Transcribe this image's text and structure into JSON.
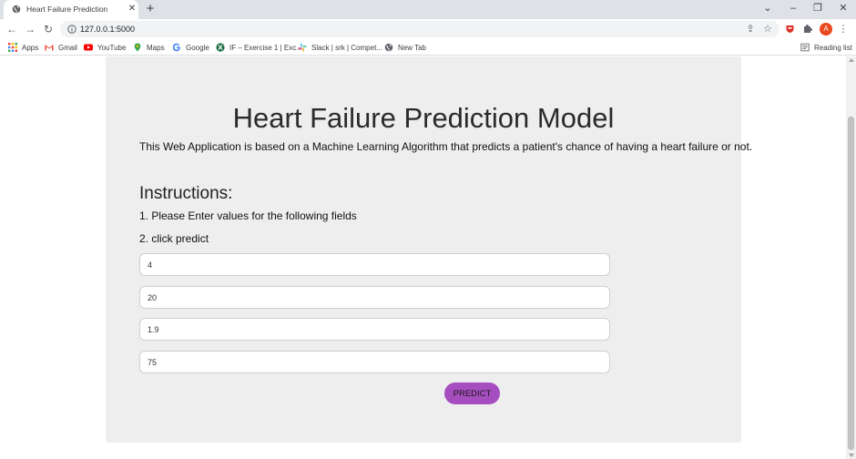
{
  "browser": {
    "tab": {
      "title": "Heart Failure Prediction",
      "close_glyph": "✕"
    },
    "new_tab_glyph": "+",
    "window_controls": {
      "dropdown": "⌄",
      "minimize": "–",
      "restore": "❐",
      "close": "✕"
    },
    "nav": {
      "back": "←",
      "forward": "→",
      "reload": "↻"
    },
    "url": "127.0.0.1:5000",
    "avatar_initial": "A",
    "menu_glyph": "⋮",
    "star_glyph": "☆",
    "share_glyph": "⇪",
    "bookmarks": [
      {
        "label": "Apps",
        "icon": "apps-grid-icon",
        "color": "#5f6368"
      },
      {
        "label": "Gmail",
        "icon": "gmail-icon",
        "color": "#ea4335"
      },
      {
        "label": "YouTube",
        "icon": "youtube-icon",
        "color": "#ff0000"
      },
      {
        "label": "Maps",
        "icon": "maps-pin-icon",
        "color": "#34a853"
      },
      {
        "label": "Google",
        "icon": "google-icon",
        "color": "#4285f4"
      },
      {
        "label": "IF – Exercise 1 | Exc...",
        "icon": "excel-icon",
        "color": "#1e7145"
      },
      {
        "label": "Slack | srk | Compet...",
        "icon": "slack-icon",
        "color": "#611f69"
      },
      {
        "label": "New Tab",
        "icon": "globe-icon",
        "color": "#5f6368"
      }
    ],
    "reading_list": "Reading list"
  },
  "page": {
    "title": "Heart Failure Prediction Model",
    "subtitle": "This Web Application is based on a Machine Learning Algorithm that predicts a patient's chance of having a heart failure or not.",
    "instructions_heading": "Instructions:",
    "steps": [
      "1. Please Enter values for the following fields",
      "2. click predict"
    ],
    "fields": [
      {
        "value": "4"
      },
      {
        "value": "20"
      },
      {
        "value": "1.9"
      },
      {
        "value": "75"
      }
    ],
    "predict_label": "PREDICT",
    "colors": {
      "card_bg": "#eeeeee",
      "button_bg": "#a64dbf"
    }
  }
}
